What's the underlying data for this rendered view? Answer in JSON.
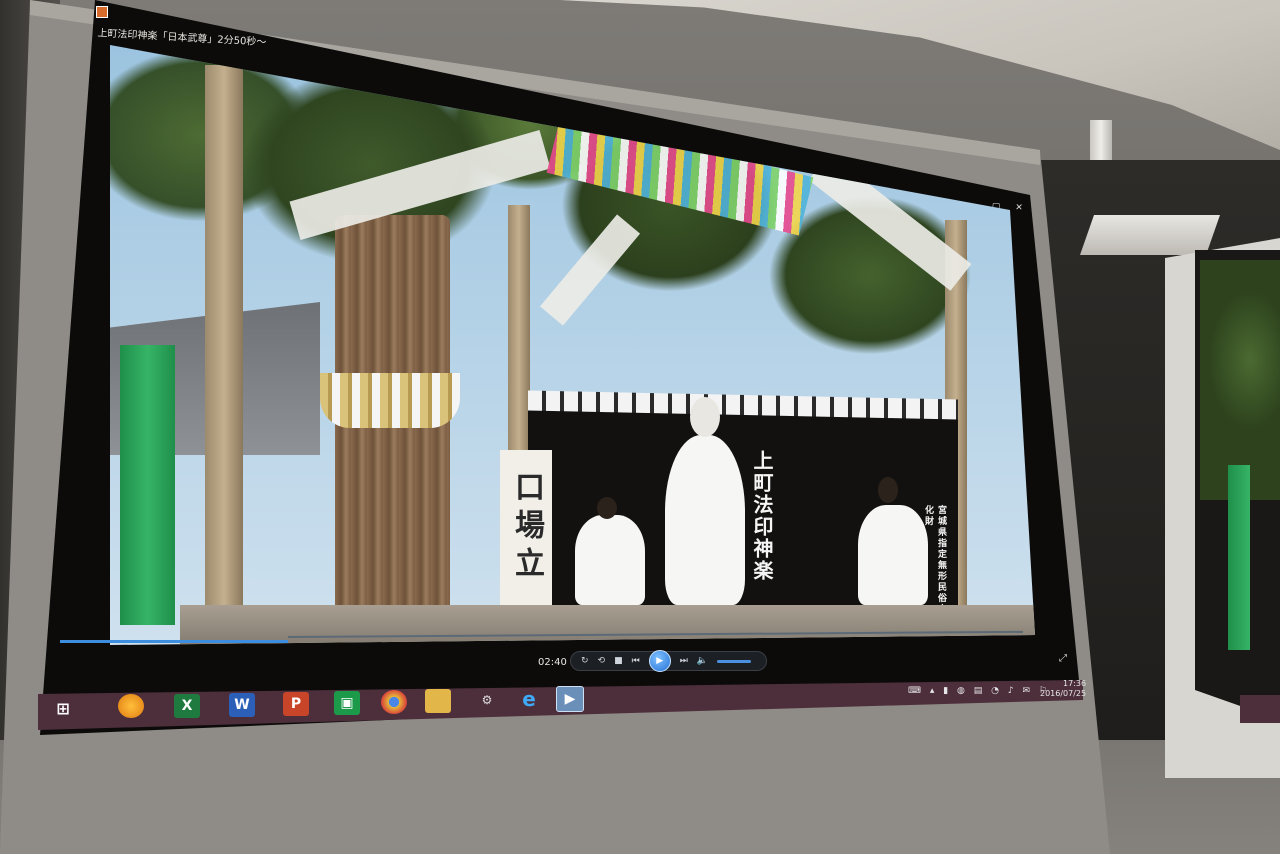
{
  "player_window": {
    "title": "上町法印神楽「日本武尊」2分50秒～",
    "time_elapsed": "02:40",
    "progress": 0.25,
    "controls": [
      "repeat-icon",
      "shuffle-icon",
      "stop-icon",
      "previous-icon",
      "play-icon",
      "next-icon",
      "volume-icon",
      "volume-slider"
    ]
  },
  "video_scene": {
    "banner_text_1": "上町法印神楽",
    "banner_text_2": "宮城県指定無形民俗文化財",
    "sign_text": "口場立"
  },
  "taskbar": {
    "items": [
      {
        "name": "start-icon"
      },
      {
        "name": "app-icon-orange"
      },
      {
        "name": "excel-icon",
        "label": "X"
      },
      {
        "name": "word-icon",
        "label": "W"
      },
      {
        "name": "powerpoint-icon",
        "label": "P"
      },
      {
        "name": "publisher-icon"
      },
      {
        "name": "chrome-icon"
      },
      {
        "name": "file-explorer-icon"
      },
      {
        "name": "media-icon"
      },
      {
        "name": "internet-explorer-icon",
        "label": "e"
      },
      {
        "name": "media-player-icon"
      }
    ],
    "clock_time": "17:36",
    "clock_date": "2016/07/25"
  },
  "colors": {
    "taskbar": "#4d2f3c",
    "seekbar": "#3e8ee0",
    "accent_green": "#36b466"
  }
}
